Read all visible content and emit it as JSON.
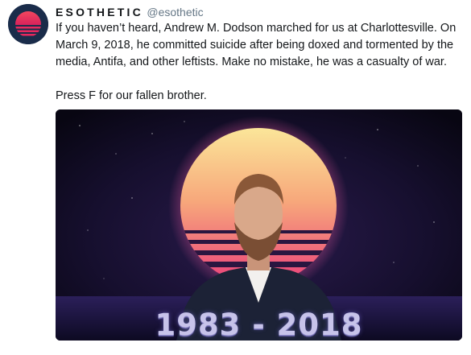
{
  "tweet": {
    "display_name": "ESOTHETIC",
    "handle": "@esothetic",
    "text_paragraph_1": "If you haven’t heard, Andrew M. Dodson marched for us at Charlottesville. On March 9, 2018, he committed suicide after being doxed and tormented by the media, Antifa, and other leftists. Make no mistake, he was a casualty of war.",
    "text_paragraph_2": "Press F for our fallen brother."
  },
  "media": {
    "overlay_text": "1983 - 2018"
  },
  "colors": {
    "name_text": "#14171a",
    "handle_text": "#657786",
    "avatar_bg": "#1a2c4a",
    "sun_top": "#f7e28a",
    "sun_bottom": "#e8337a",
    "space_bg": "#0e0a1c"
  },
  "icons": {
    "avatar": "sunset-logo-icon"
  }
}
